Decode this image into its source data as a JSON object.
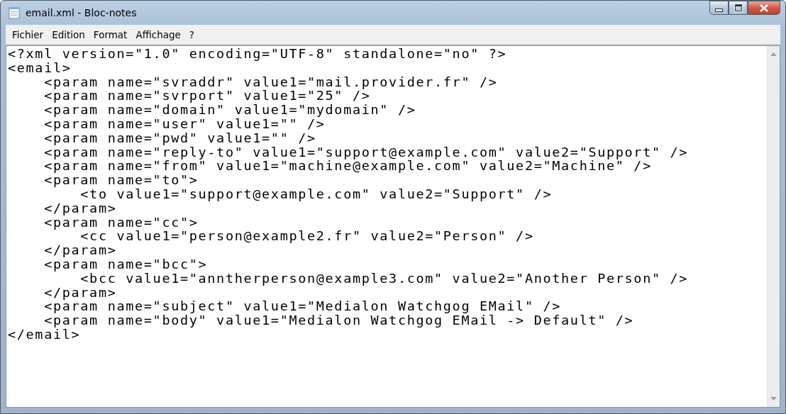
{
  "window": {
    "title": "email.xml - Bloc-notes"
  },
  "menu": [
    "Fichier",
    "Edition",
    "Format",
    "Affichage",
    "?"
  ],
  "editor": {
    "lines": [
      "<?xml version=\"1.0\" encoding=\"UTF-8\" standalone=\"no\" ?>",
      "<email>",
      "    <param name=\"svraddr\" value1=\"mail.provider.fr\" />",
      "    <param name=\"svrport\" value1=\"25\" />",
      "    <param name=\"domain\" value1=\"mydomain\" />",
      "    <param name=\"user\" value1=\"\" />",
      "    <param name=\"pwd\" value1=\"\" />",
      "    <param name=\"reply-to\" value1=\"support@example.com\" value2=\"Support\" />",
      "    <param name=\"from\" value1=\"machine@example.com\" value2=\"Machine\" />",
      "    <param name=\"to\">",
      "        <to value1=\"support@example.com\" value2=\"Support\" />",
      "    </param>",
      "    <param name=\"cc\">",
      "        <cc value1=\"person@example2.fr\" value2=\"Person\" />",
      "    </param>",
      "    <param name=\"bcc\">",
      "        <bcc value1=\"anntherperson@example3.com\" value2=\"Another Person\" />",
      "    </param>",
      "    <param name=\"subject\" value1=\"Medialon Watchgog EMail\" />",
      "    <param name=\"body\" value1=\"Medialon Watchgog EMail -> Default\" />",
      "</email>"
    ]
  }
}
